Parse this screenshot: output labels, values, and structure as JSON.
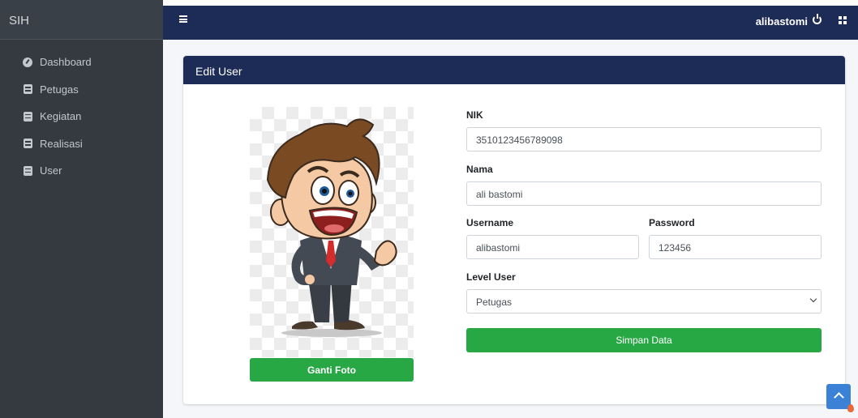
{
  "brand": "SIH",
  "sidebar": {
    "items": [
      {
        "label": "Dashboard",
        "icon": "dashboard-icon"
      },
      {
        "label": "Petugas",
        "icon": "book-icon"
      },
      {
        "label": "Kegiatan",
        "icon": "book-icon"
      },
      {
        "label": "Realisasi",
        "icon": "book-icon"
      },
      {
        "label": "User",
        "icon": "book-icon"
      }
    ]
  },
  "topbar": {
    "username": "alibastomi",
    "menu_icon": "hamburger-icon",
    "power_icon": "power-icon",
    "apps_icon": "grid-icon"
  },
  "card": {
    "title": "Edit User",
    "change_photo_label": "Ganti Foto",
    "form": {
      "nik_label": "NIK",
      "nik_value": "3510123456789098",
      "nama_label": "Nama",
      "nama_value": "ali bastomi",
      "username_label": "Username",
      "username_value": "alibastomi",
      "password_label": "Password",
      "password_value": "123456",
      "level_label": "Level User",
      "level_value": "Petugas",
      "submit_label": "Simpan Data"
    }
  },
  "colors": {
    "header": "#1d2b57",
    "sidebar": "#343a40",
    "button": "#28a745",
    "scroll_button": "#3b82d6"
  }
}
